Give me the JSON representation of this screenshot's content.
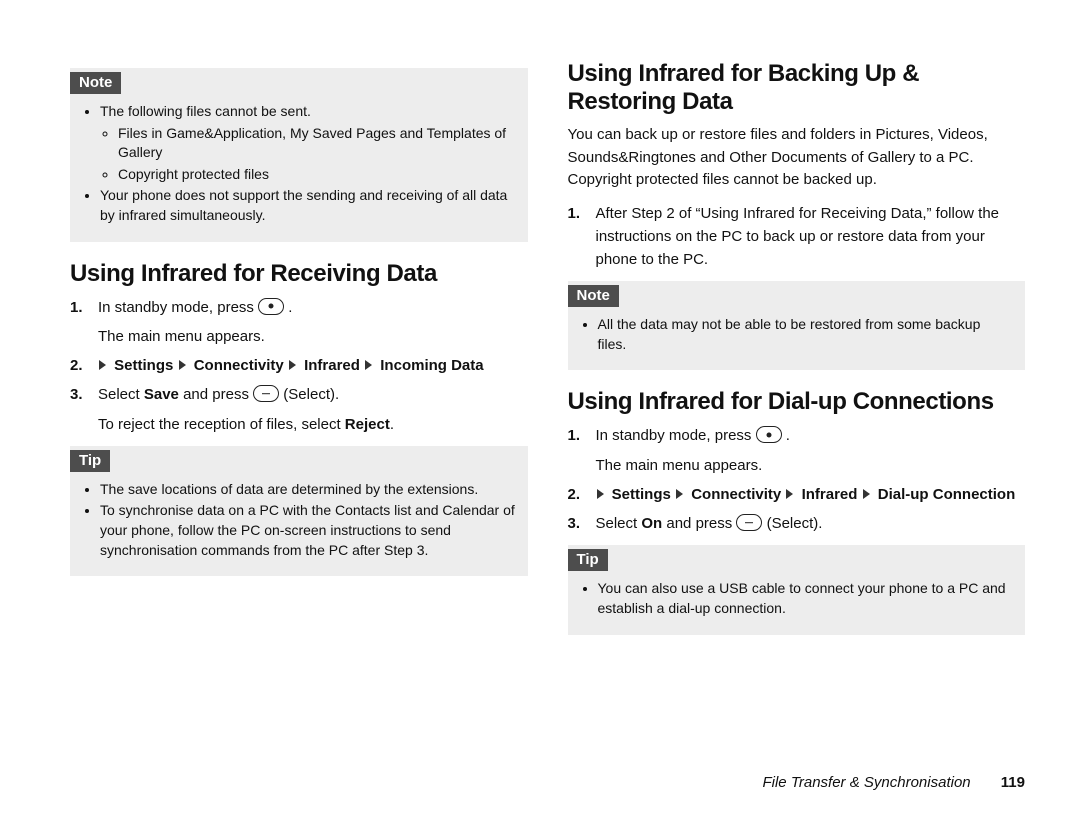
{
  "left": {
    "note1": {
      "label": "Note",
      "b1": "The following files cannot be sent.",
      "b1a": "Files in Game&Application, My Saved Pages and Templates of Gallery",
      "b1b": "Copyright protected files",
      "b2": "Your phone does not support the sending and receiving of all data by infrared simultaneously."
    },
    "h_recv": "Using Infrared for Receiving Data",
    "s1a": "In standby mode, press ",
    "s1b": ".",
    "s1c": "The main menu appears.",
    "nav": {
      "a": "Settings",
      "b": "Connectivity",
      "c": "Infrared",
      "d": "Incoming Data"
    },
    "s3a": "Select ",
    "s3b": "Save",
    "s3c": " and press ",
    "s3d": " (Select).",
    "s3e": "To reject the reception of files, select ",
    "s3f": "Reject",
    "s3g": ".",
    "tip1": {
      "label": "Tip",
      "b1": "The save locations of data are determined by the extensions.",
      "b2": "To synchronise data on a PC with the Contacts list and Calendar of your phone, follow the PC on-screen instructions to send synchronisation commands from the PC after Step 3."
    }
  },
  "right": {
    "h_backup": "Using Infrared for Backing Up & Restoring Data",
    "p_backup": "You can back up or restore files and folders in Pictures, Videos, Sounds&Ringtones and Other Documents of Gallery to a PC. Copyright protected files cannot be backed up.",
    "s1": "After Step 2 of “Using Infrared for Receiving Data,” follow the instructions on the PC to back up or restore data from your phone to the PC.",
    "note2": {
      "label": "Note",
      "b1": "All the data may not be able to be restored from some backup files."
    },
    "h_dial": "Using Infrared for Dial-up Connections",
    "d1a": "In standby mode, press ",
    "d1b": ".",
    "d1c": "The main menu appears.",
    "nav": {
      "a": "Settings",
      "b": "Connectivity",
      "c": "Infrared",
      "d": "Dial-up Connection"
    },
    "d3a": "Select ",
    "d3b": "On",
    "d3c": " and press ",
    "d3d": " (Select).",
    "tip2": {
      "label": "Tip",
      "b1": "You can also use a USB cable to connect your phone to a PC and establish a dial-up connection."
    }
  },
  "footer": {
    "title": "File Transfer & Synchronisation",
    "page": "119"
  }
}
